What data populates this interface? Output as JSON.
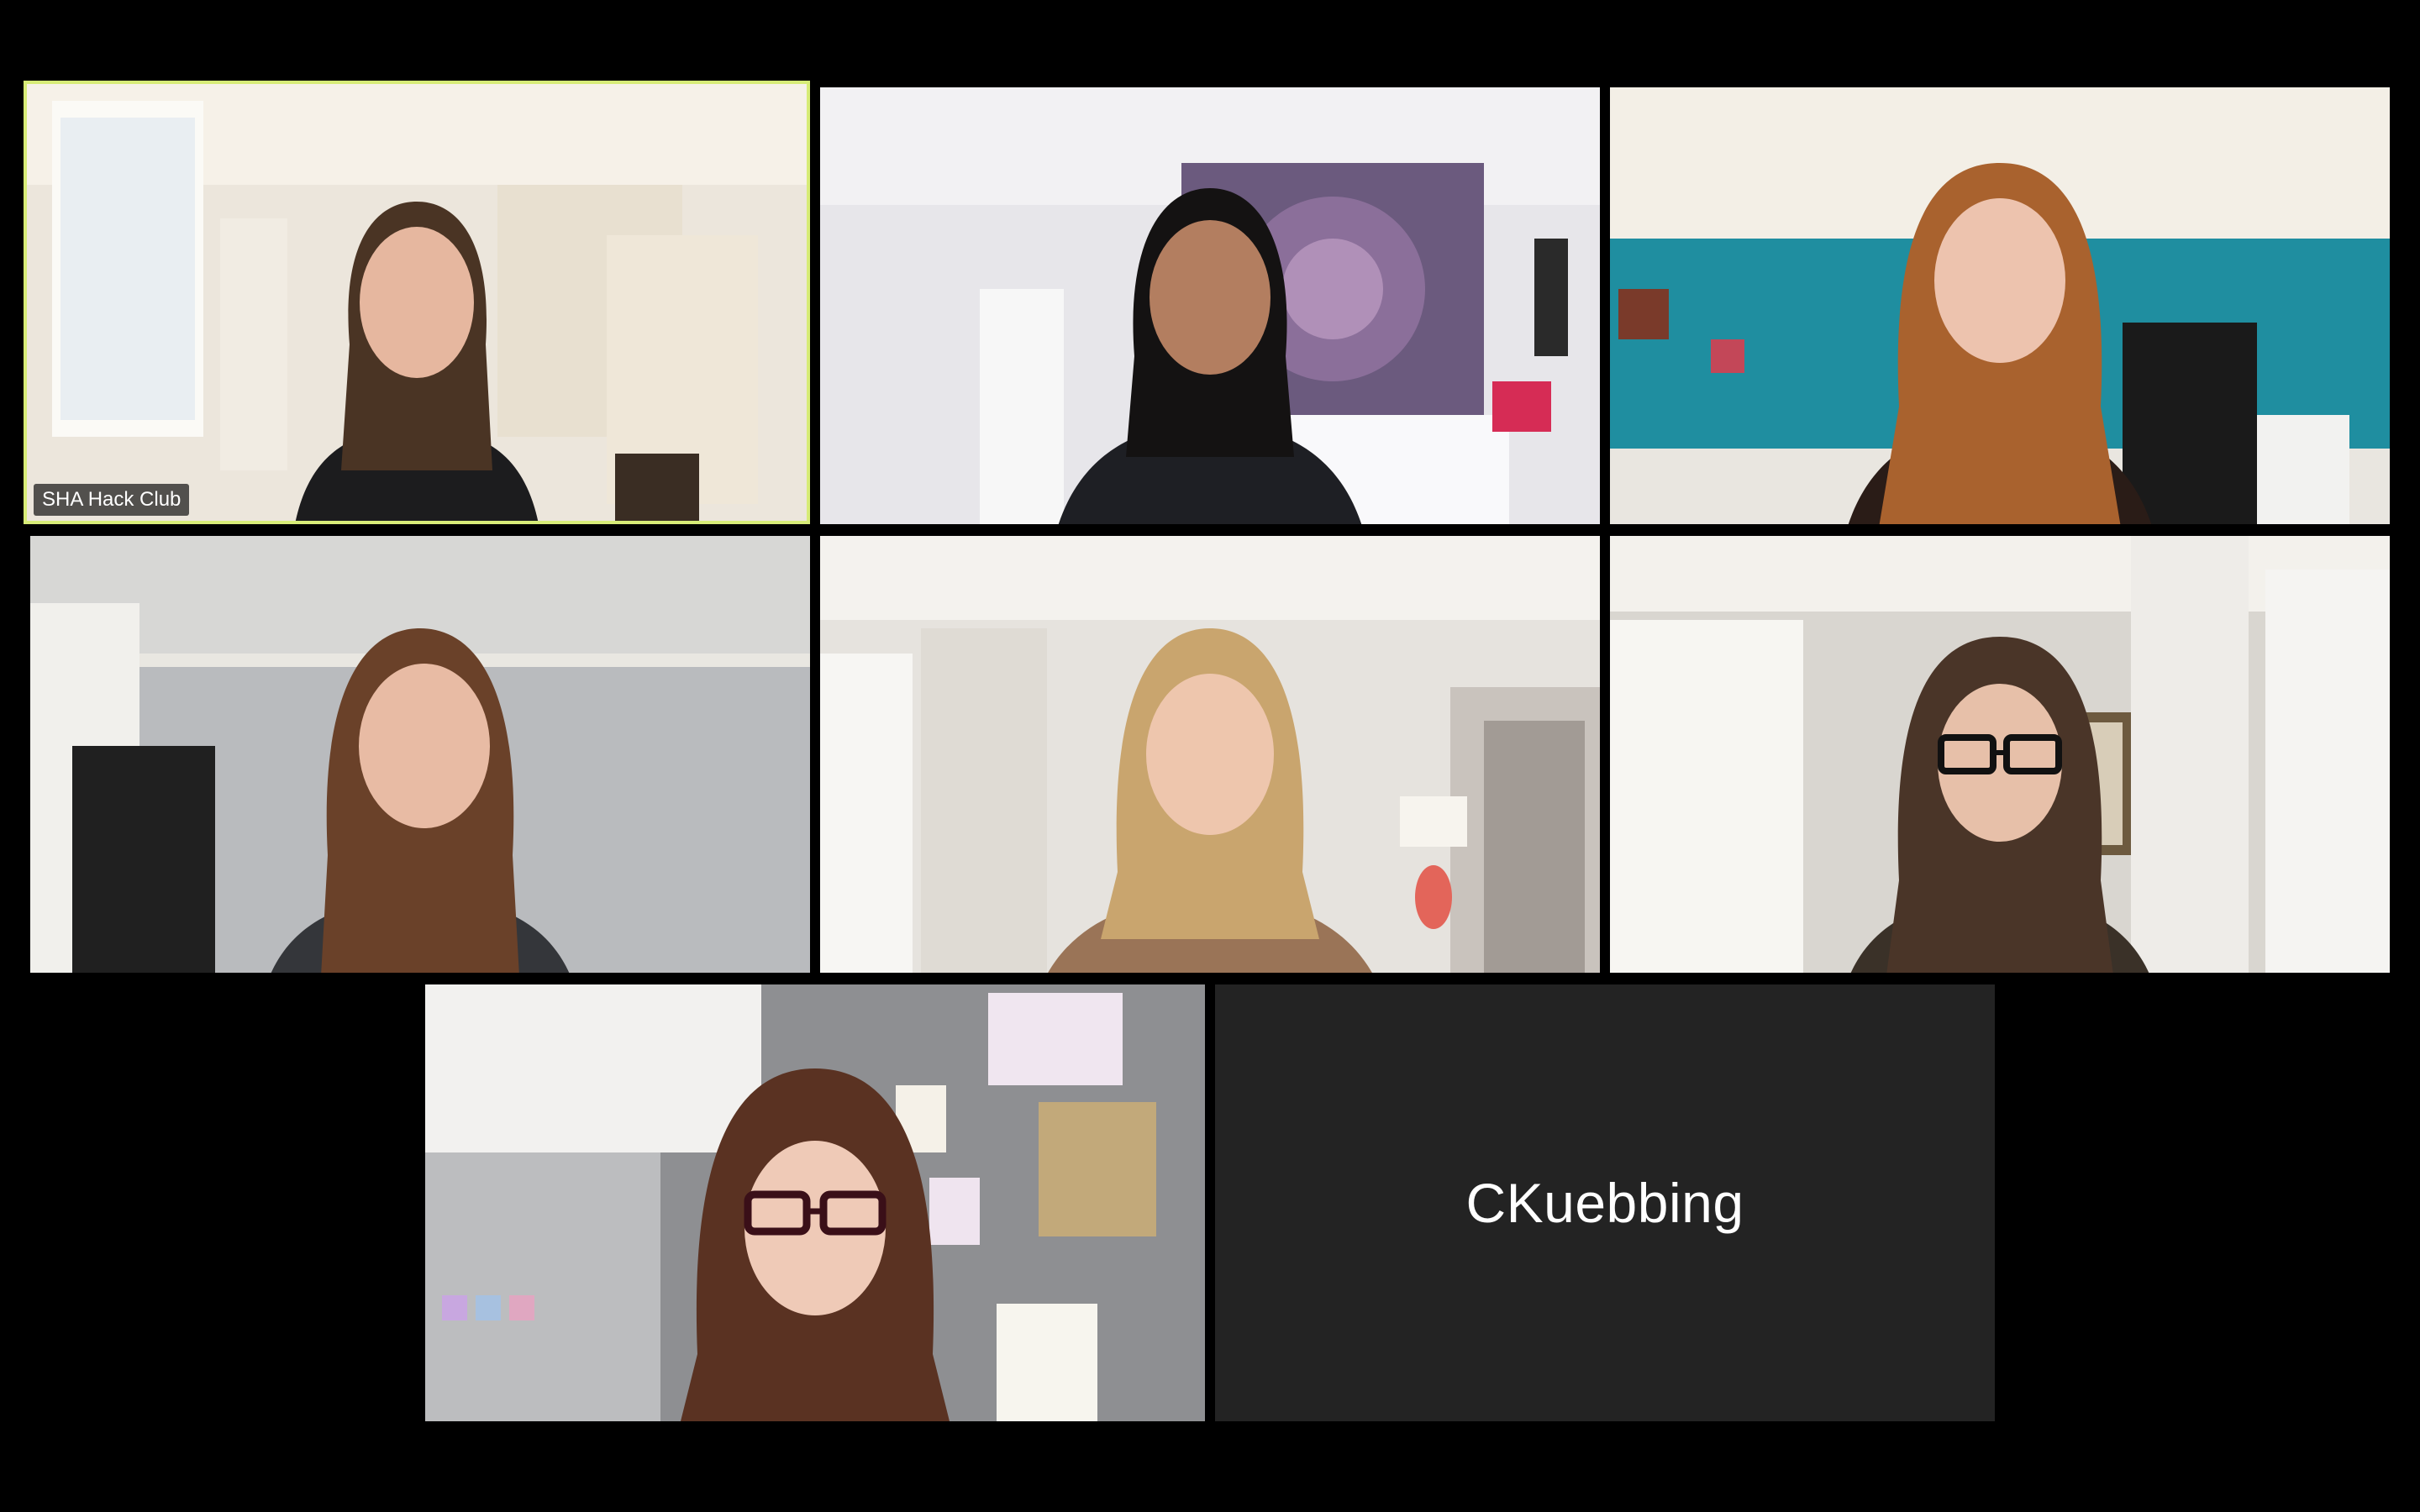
{
  "meeting": {
    "view": "gallery",
    "active_speaker_color": "#d7ec77"
  },
  "participants": [
    {
      "label": "SHA Hack Club",
      "video": true,
      "active": true
    },
    {
      "label": "",
      "video": true,
      "active": false
    },
    {
      "label": "",
      "video": true,
      "active": false
    },
    {
      "label": "",
      "video": true,
      "active": false
    },
    {
      "label": "",
      "video": true,
      "active": false
    },
    {
      "label": "",
      "video": true,
      "active": false
    },
    {
      "label": "",
      "video": true,
      "active": false
    },
    {
      "label": "CKuebbing",
      "video": false,
      "active": false
    }
  ]
}
